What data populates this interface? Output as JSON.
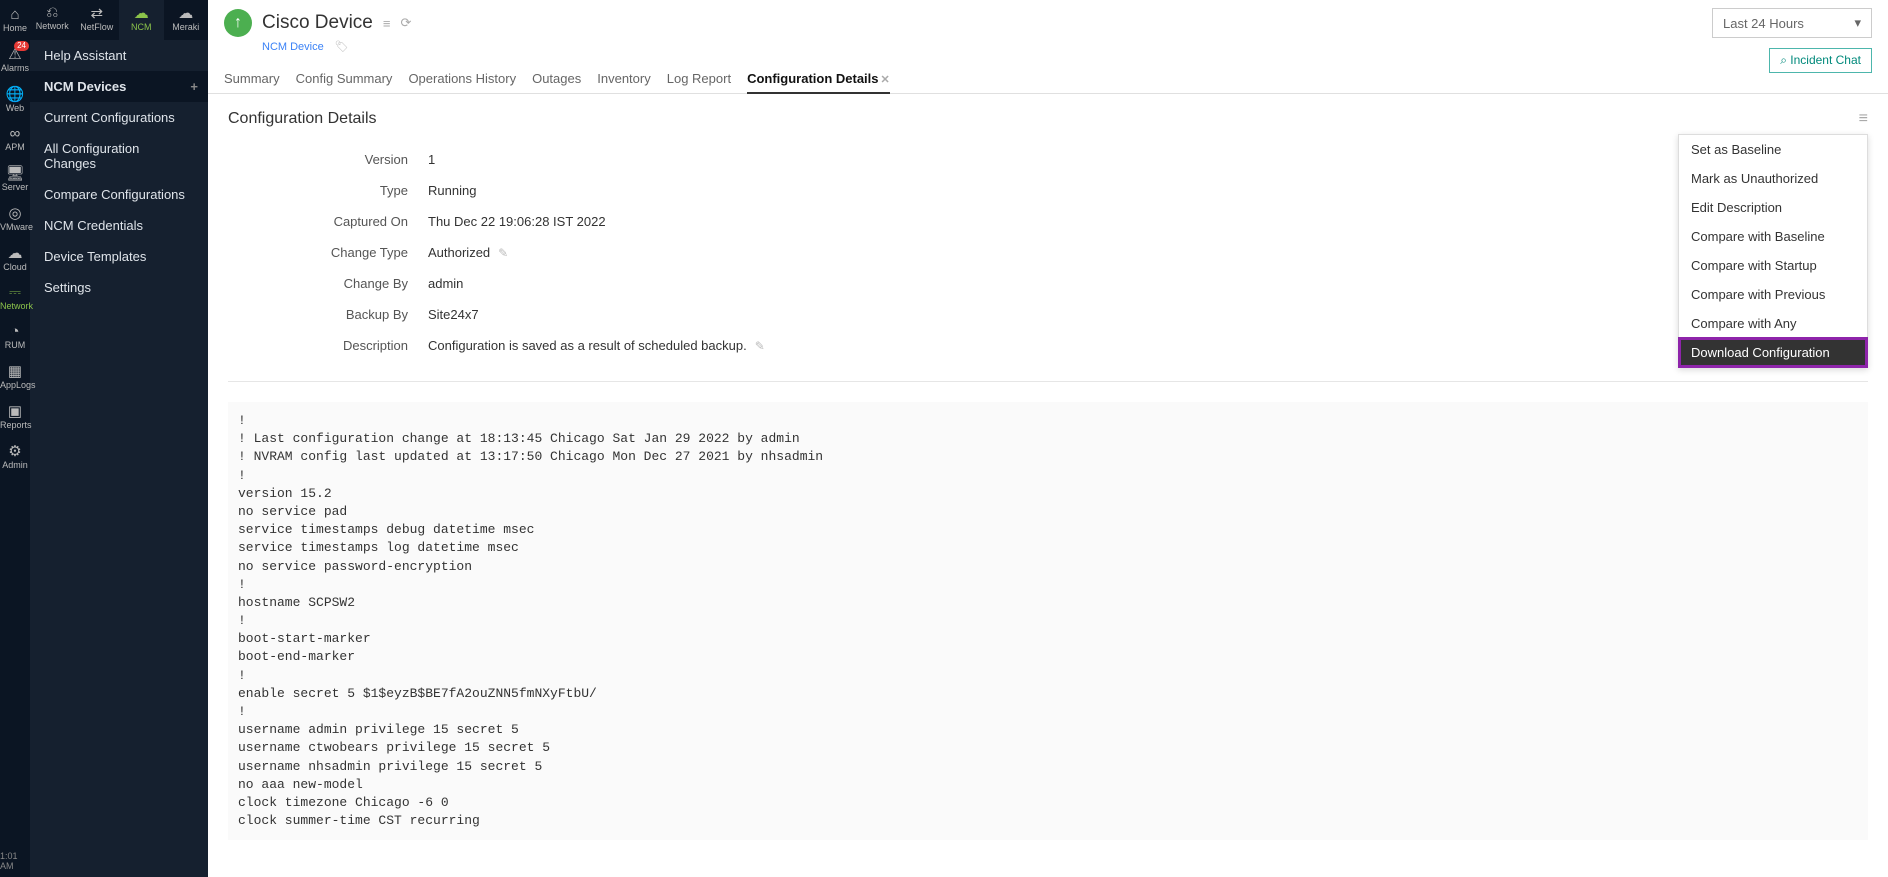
{
  "iconbar": {
    "items": [
      {
        "icon": "⌂",
        "label": "Home"
      },
      {
        "icon": "⚠",
        "label": "Alarms",
        "badge": "24"
      },
      {
        "icon": "🌐",
        "label": "Web"
      },
      {
        "icon": "∞",
        "label": "APM"
      },
      {
        "icon": "🖥",
        "label": "Server"
      },
      {
        "icon": "◎",
        "label": "VMware"
      },
      {
        "icon": "☁",
        "label": "Cloud"
      },
      {
        "icon": "⎓",
        "label": "Network",
        "active": true
      },
      {
        "icon": "◔",
        "label": "RUM"
      },
      {
        "icon": "▦",
        "label": "AppLogs"
      },
      {
        "icon": "▣",
        "label": "Reports"
      },
      {
        "icon": "⚙",
        "label": "Admin"
      }
    ],
    "time": "1:01 AM"
  },
  "topnav": [
    {
      "icon": "⎌",
      "label": "Network"
    },
    {
      "icon": "⇄",
      "label": "NetFlow"
    },
    {
      "icon": "☁",
      "label": "NCM",
      "active": true
    },
    {
      "icon": "☁",
      "label": "Meraki"
    }
  ],
  "sidebar": {
    "items": [
      {
        "label": "Help Assistant"
      },
      {
        "label": "NCM Devices",
        "section": true,
        "add": true
      },
      {
        "label": "Current Configurations"
      },
      {
        "label": "All Configuration Changes"
      },
      {
        "label": "Compare Configurations"
      },
      {
        "label": "NCM Credentials"
      },
      {
        "label": "Device Templates"
      },
      {
        "label": "Settings"
      }
    ]
  },
  "header": {
    "title": "Cisco Device",
    "breadcrumb": "NCM Device",
    "timerange": "Last 24 Hours",
    "incident": "Incident Chat"
  },
  "tabs": [
    {
      "label": "Summary"
    },
    {
      "label": "Config Summary"
    },
    {
      "label": "Operations History"
    },
    {
      "label": "Outages"
    },
    {
      "label": "Inventory"
    },
    {
      "label": "Log Report"
    },
    {
      "label": "Configuration Details",
      "active": true,
      "closable": true
    }
  ],
  "section_title": "Configuration Details",
  "details": [
    {
      "k": "Version",
      "v": "1"
    },
    {
      "k": "Type",
      "v": "Running"
    },
    {
      "k": "Captured On",
      "v": "Thu Dec 22 19:06:28 IST 2022"
    },
    {
      "k": "Change Type",
      "v": "Authorized",
      "editable": true
    },
    {
      "k": "Change By",
      "v": "admin"
    },
    {
      "k": "Backup By",
      "v": "Site24x7"
    },
    {
      "k": "Description",
      "v": "Configuration is saved as a result of scheduled backup.",
      "editable": true
    }
  ],
  "dropdown": [
    {
      "label": "Set as Baseline"
    },
    {
      "label": "Mark as Unauthorized"
    },
    {
      "label": "Edit Description"
    },
    {
      "label": "Compare with Baseline"
    },
    {
      "label": "Compare with Startup"
    },
    {
      "label": "Compare with Previous"
    },
    {
      "label": "Compare with Any"
    },
    {
      "label": "Download Configuration",
      "highlight": true
    }
  ],
  "config_text": "!\n! Last configuration change at 18:13:45 Chicago Sat Jan 29 2022 by admin\n! NVRAM config last updated at 13:17:50 Chicago Mon Dec 27 2021 by nhsadmin\n!\nversion 15.2\nno service pad\nservice timestamps debug datetime msec\nservice timestamps log datetime msec\nno service password-encryption\n!\nhostname SCPSW2\n!\nboot-start-marker\nboot-end-marker\n!\nenable secret 5 $1$eyzB$BE7fA2ouZNN5fmNXyFtbU/\n!\nusername admin privilege 15 secret 5\nusername ctwobears privilege 15 secret 5\nusername nhsadmin privilege 15 secret 5\nno aaa new-model\nclock timezone Chicago -6 0\nclock summer-time CST recurring"
}
